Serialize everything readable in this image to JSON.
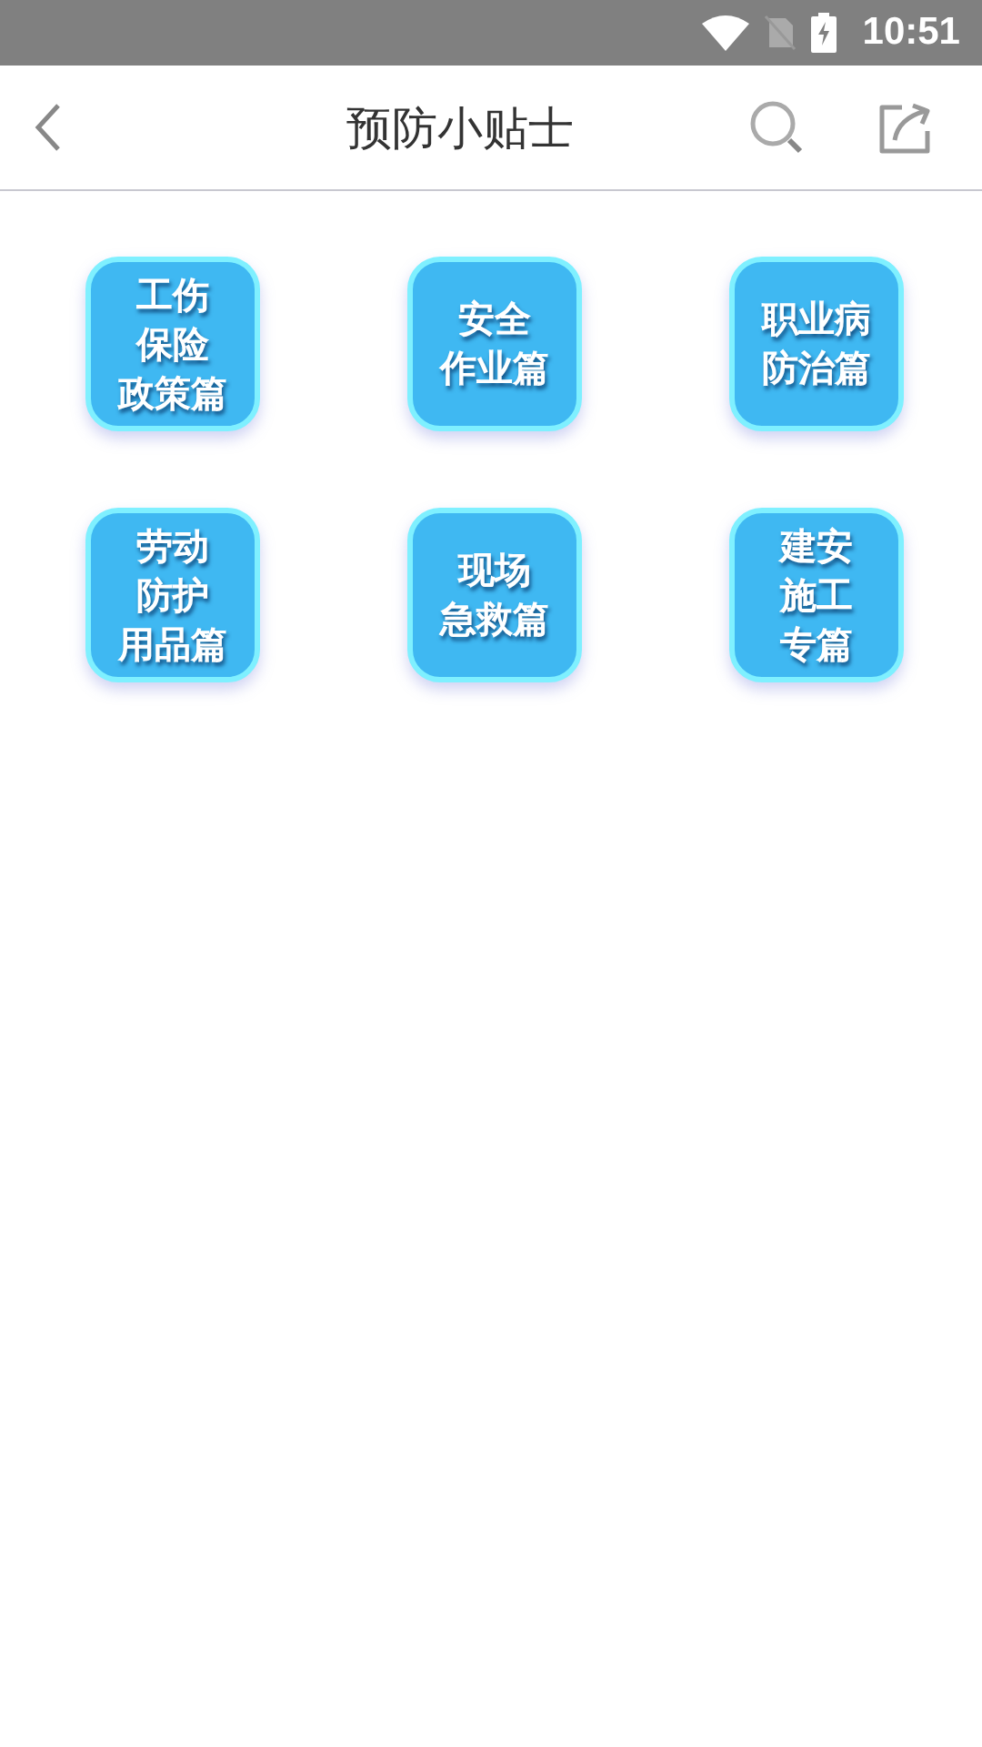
{
  "status_bar": {
    "time": "10:51"
  },
  "header": {
    "title": "预防小贴士"
  },
  "tiles": [
    {
      "lines": [
        "工伤",
        "保险",
        "政策篇"
      ]
    },
    {
      "lines": [
        "安全",
        "作业篇"
      ]
    },
    {
      "lines": [
        "职业病",
        "防治篇"
      ]
    },
    {
      "lines": [
        "劳动",
        "防护",
        "用品篇"
      ]
    },
    {
      "lines": [
        "现场",
        "急救篇"
      ]
    },
    {
      "lines": [
        "建安",
        "施工",
        "专篇"
      ]
    }
  ]
}
